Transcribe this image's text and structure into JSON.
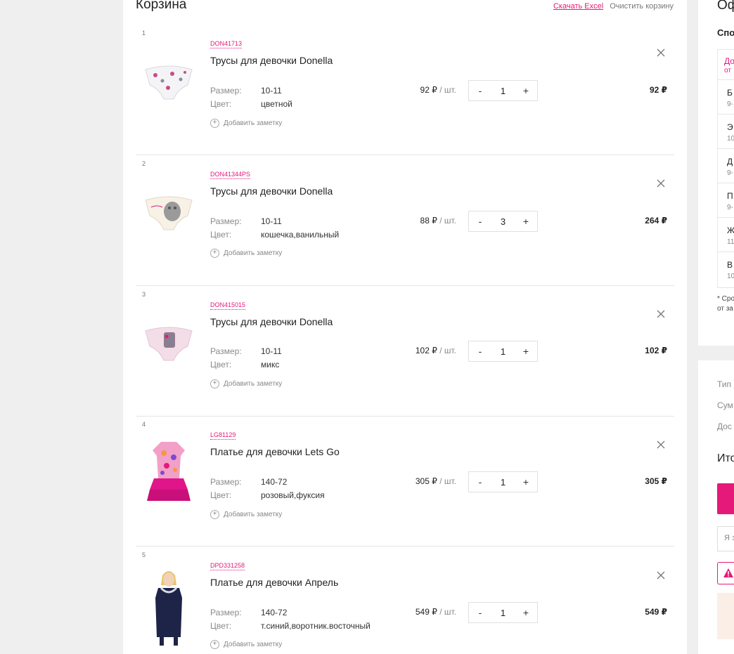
{
  "cart": {
    "title": "Корзина",
    "download_excel": "Скачать Excel",
    "clear_cart": "Очистить корзину",
    "add_note_label": "Добавить заметку",
    "size_label": "Размер:",
    "color_label": "Цвет:",
    "per_unit": "/ шт.",
    "items": [
      {
        "index": "1",
        "sku": "DON41713",
        "name": "Трусы для девочки Donella",
        "size": "10-11",
        "color": "цветной",
        "unit_price": "92 ₽",
        "qty": "1",
        "total": "92 ₽"
      },
      {
        "index": "2",
        "sku": "DON41344PS",
        "name": "Трусы для девочки Donella",
        "size": "10-11",
        "color": "кошечка,ванильный",
        "unit_price": "88 ₽",
        "qty": "3",
        "total": "264 ₽"
      },
      {
        "index": "3",
        "sku": "DON415015",
        "name": "Трусы для девочки Donella",
        "size": "10-11",
        "color": "микс",
        "unit_price": "102 ₽",
        "qty": "1",
        "total": "102 ₽"
      },
      {
        "index": "4",
        "sku": "LG81129",
        "name": "Платье для девочки Lets Go",
        "size": "140-72",
        "color": "розовый,фуксия",
        "unit_price": "305 ₽",
        "qty": "1",
        "total": "305 ₽"
      },
      {
        "index": "5",
        "sku": "DPD331258",
        "name": "Платье для девочки Апрель",
        "size": "140-72",
        "color": "т.синий,воротник.восточный",
        "unit_price": "549 ₽",
        "qty": "1",
        "total": "549 ₽"
      }
    ]
  },
  "side": {
    "title": "Оф",
    "subtitle": "Спо",
    "box_head_1": "До",
    "box_head_2": "от",
    "rows": [
      {
        "a": "Б",
        "b": "9-"
      },
      {
        "a": "Э",
        "b": "10"
      },
      {
        "a": "Д",
        "b": "9-"
      },
      {
        "a": "П",
        "b": "9-"
      },
      {
        "a": "Ж",
        "b": "11"
      },
      {
        "a": "В",
        "b": "10"
      }
    ],
    "note_1": "* Сро",
    "note_2": "от за",
    "type_label": "Тип",
    "sum_label": "Сум",
    "delivery_label": "Дос",
    "total_label": "Ито",
    "input_placeholder": "Я з"
  },
  "colors": {
    "accent": "#e5197a"
  }
}
